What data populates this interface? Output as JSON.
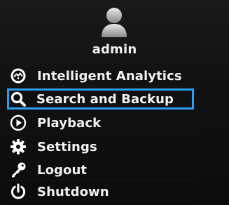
{
  "user": {
    "avatar_icon": "user-avatar-icon",
    "name": "admin"
  },
  "menu": {
    "selected_index": 1,
    "highlight_color": "#2a9df4",
    "items": [
      {
        "label": "Intelligent Analytics",
        "icon": "analytics-icon"
      },
      {
        "label": "Search and Backup",
        "icon": "search-icon"
      },
      {
        "label": "Playback",
        "icon": "play-icon"
      },
      {
        "label": "Settings",
        "icon": "gear-icon"
      },
      {
        "label": "Logout",
        "icon": "key-icon"
      },
      {
        "label": "Shutdown",
        "icon": "power-icon"
      }
    ]
  }
}
